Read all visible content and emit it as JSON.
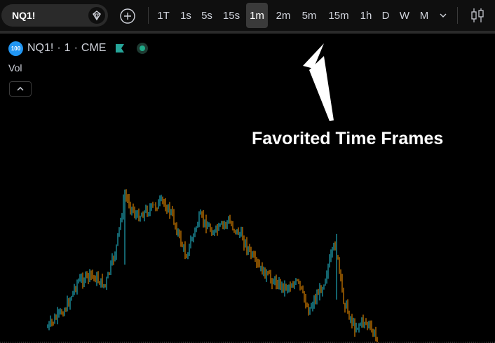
{
  "toolbar": {
    "symbol": "NQ1!",
    "timeframes": [
      {
        "label": "1T",
        "active": false
      },
      {
        "label": "1s",
        "active": false
      },
      {
        "label": "5s",
        "active": false
      },
      {
        "label": "15s",
        "active": false
      },
      {
        "label": "1m",
        "active": true
      },
      {
        "label": "2m",
        "active": false
      },
      {
        "label": "5m",
        "active": false
      },
      {
        "label": "15m",
        "active": false
      },
      {
        "label": "1h",
        "active": false
      },
      {
        "label": "D",
        "active": false
      },
      {
        "label": "W",
        "active": false
      },
      {
        "label": "M",
        "active": false
      }
    ],
    "icons": {
      "symbol_search": "diamond-search-icon",
      "add_symbol": "plus-circle-icon",
      "more_timeframes": "chevron-down-icon",
      "chart_type": "candlestick-icon"
    }
  },
  "legend": {
    "badge": "100",
    "symbol": "NQ1!",
    "separator1": "·",
    "interval": "1",
    "separator2": "·",
    "exchange": "CME",
    "flag_icon": "flag-icon",
    "status_icon": "market-open-dot-icon"
  },
  "volume": {
    "label": "Vol",
    "collapse_icon": "chevron-up-icon"
  },
  "annotation": {
    "text": "Favorited Time Frames"
  },
  "colors": {
    "background": "#000000",
    "toolbar": "#0f0f0f",
    "active_tab": "#3a3a3a",
    "up": "#26c6da",
    "down": "#ff9800",
    "badge": "#2196f3",
    "status": "#1fab89"
  }
}
